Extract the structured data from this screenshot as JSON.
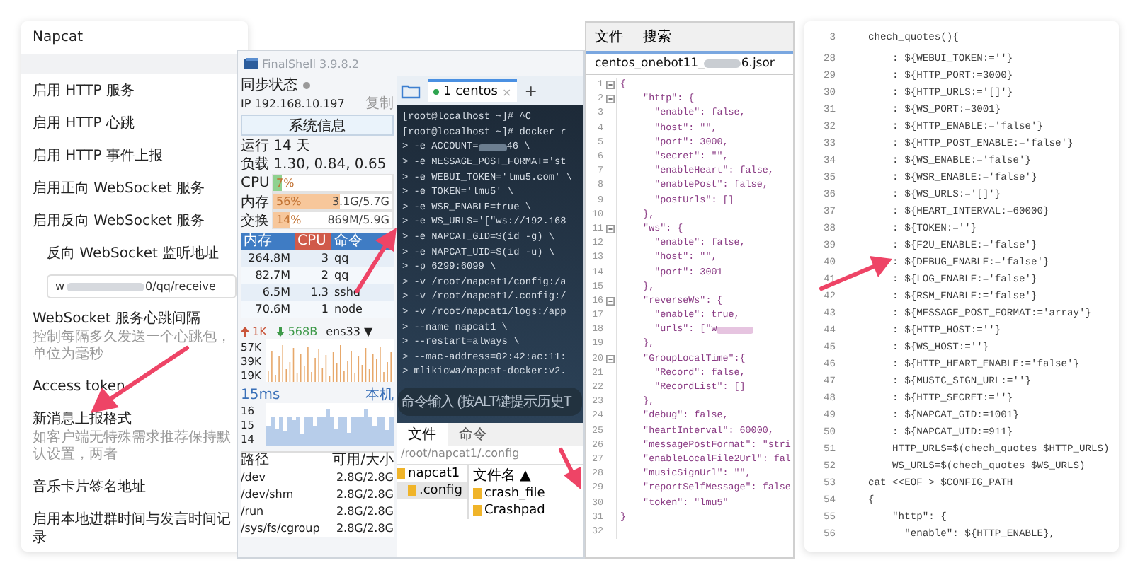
{
  "settings_panel": {
    "title": "Napcat",
    "items": [
      {
        "kind": "row",
        "label": "启用 HTTP 服务"
      },
      {
        "kind": "row",
        "label": "启用 HTTP 心跳"
      },
      {
        "kind": "row",
        "label": "启用 HTTP 事件上报"
      },
      {
        "kind": "row",
        "label": "启用正向 WebSocket 服务"
      },
      {
        "kind": "row",
        "label": "启用反向 WebSocket 服务"
      },
      {
        "kind": "sub",
        "label": "反向 WebSocket 监听地址"
      },
      {
        "kind": "field",
        "value_start": "w",
        "value_end": "0/qq/receive"
      },
      {
        "kind": "row",
        "label": "WebSocket 服务心跳间隔",
        "hint": "控制每隔多久发送一个心跳包，单位为毫秒"
      },
      {
        "kind": "row",
        "label": "Access token"
      },
      {
        "kind": "row",
        "label": "新消息上报格式",
        "hint": "如客户端无特殊需求推荐保持默认设置，两者"
      },
      {
        "kind": "row",
        "label": "音乐卡片签名地址"
      },
      {
        "kind": "row",
        "label": "启用本地进群时间与发言时间记录"
      }
    ]
  },
  "finalshell": {
    "title": "FinalShell 3.9.8.2",
    "sync_label": "同步状态",
    "ip": "IP  192.168.10.197",
    "copy": "复制",
    "sysinfo_button": "系统信息",
    "uptime": "运行 14 天",
    "load": "负载 1.30, 0.84, 0.65",
    "meters": [
      {
        "name": "CPU",
        "percent": "7%",
        "level": 0.07,
        "color": "#8fd18f"
      },
      {
        "name": "内存",
        "percent": "56%",
        "level": 0.56,
        "reading": "3.1G/5.7G",
        "color": "#f7c79b"
      },
      {
        "name": "交换",
        "percent": "14%",
        "level": 0.14,
        "reading": "869M/5.9G",
        "color": "#f7c79b"
      }
    ],
    "processes": {
      "columns": [
        {
          "label": "内存",
          "selected": false
        },
        {
          "label": "CPU",
          "selected": true
        },
        {
          "label": "命令",
          "selected": false
        }
      ],
      "rows": [
        [
          "264.8M",
          "3",
          "qq"
        ],
        [
          "82.7M",
          "2",
          "qq"
        ],
        [
          "6.5M",
          "1.3",
          "sshd"
        ],
        [
          "70.6M",
          "1",
          "node"
        ]
      ]
    },
    "network": {
      "up": "1K",
      "down": "568B",
      "interface": "ens33 ▼",
      "axis": [
        "57K",
        "39K",
        "19K"
      ]
    },
    "ping": {
      "latency": "15ms",
      "host": "本机",
      "axis": [
        "16",
        "15",
        "14"
      ]
    },
    "disks": {
      "columns": [
        "路径",
        "可用/大小"
      ],
      "rows": [
        [
          "/dev",
          "2.8G/2.8G"
        ],
        [
          "/dev/shm",
          "2.8G/2.8G"
        ],
        [
          "/run",
          "2.8G/2.8G"
        ],
        [
          "/sys/fs/cgroup",
          "2.8G/2.8G"
        ]
      ]
    }
  },
  "terminal": {
    "tab": "1 centos",
    "tab_close": "×",
    "new_tab": "+",
    "lines": [
      {
        "text": "[root@localhost ~]# ^C"
      },
      {
        "text": "[root@localhost ~]# docker r"
      },
      {
        "text": "> -e ACCOUNT=",
        "after_blur": "46 \\"
      },
      {
        "text": "> -e MESSAGE_POST_FORMAT='st"
      },
      {
        "text": "> -e WEBUI_TOKEN='lmu5.com' \\"
      },
      {
        "text": "> -e TOKEN='lmu5' \\"
      },
      {
        "text": "> -e WSR_ENABLE=true \\"
      },
      {
        "text": "> -e WS_URLS='[\"ws://192.168"
      },
      {
        "text": "> -e NAPCAT_GID=$(id -g) \\"
      },
      {
        "text": "> -e NAPCAT_UID=$(id -u) \\"
      },
      {
        "text": "> -p 6299:6099 \\"
      },
      {
        "text": "> -v /root/napcat1/config:/a"
      },
      {
        "text": "> -v /root/napcat1/.config:/"
      },
      {
        "text": "> -v /root/napcat1/logs:/app"
      },
      {
        "text": "> --name napcat1 \\"
      },
      {
        "text": "> --restart=always \\"
      },
      {
        "text": "> --mac-address=02:42:ac:11:"
      },
      {
        "text": "> mlikiowa/napcat-docker:v2."
      }
    ],
    "command_hint": "命令输入 (按ALT键提示历史T",
    "bottom_tabs": [
      {
        "label": "文件",
        "selected": true
      },
      {
        "label": "命令",
        "selected": false
      }
    ],
    "path": "/root/napcat1/.config",
    "tree": [
      {
        "label": "napcat1",
        "children": [
          {
            "label": ".config",
            "selected": true
          }
        ]
      }
    ],
    "file_header": "文件名 ▲",
    "files": [
      "crash_file",
      "Crashpad"
    ]
  },
  "json_editor": {
    "menu": [
      "文件",
      "搜索"
    ],
    "tab_start": "centos_onebot11_",
    "tab_end": "6.jsor",
    "lines": [
      {
        "n": "1",
        "fold": true,
        "text": "{"
      },
      {
        "n": "2",
        "fold": true,
        "text": "    \"http\": {"
      },
      {
        "n": "3",
        "fold": false,
        "text": "      \"enable\": false,"
      },
      {
        "n": "4",
        "fold": false,
        "text": "      \"host\": \"\","
      },
      {
        "n": "5",
        "fold": false,
        "text": "      \"port\": 3000,"
      },
      {
        "n": "6",
        "fold": false,
        "text": "      \"secret\": \"\","
      },
      {
        "n": "7",
        "fold": false,
        "text": "      \"enableHeart\": false,"
      },
      {
        "n": "8",
        "fold": false,
        "text": "      \"enablePost\": false,"
      },
      {
        "n": "9",
        "fold": false,
        "text": "      \"postUrls\": []"
      },
      {
        "n": "10",
        "fold": false,
        "text": "    },"
      },
      {
        "n": "11",
        "fold": true,
        "text": "    \"ws\": {"
      },
      {
        "n": "12",
        "fold": false,
        "text": "      \"enable\": false,"
      },
      {
        "n": "13",
        "fold": false,
        "text": "      \"host\": \"\","
      },
      {
        "n": "14",
        "fold": false,
        "text": "      \"port\": 3001"
      },
      {
        "n": "15",
        "fold": false,
        "text": "    },"
      },
      {
        "n": "16",
        "fold": true,
        "text": "    \"reverseWs\": {"
      },
      {
        "n": "17",
        "fold": false,
        "text": "      \"enable\": true,"
      },
      {
        "n": "18",
        "fold": false,
        "text": "      \"urls\": [\"w",
        "blurred": true
      },
      {
        "n": "19",
        "fold": false,
        "text": "    },"
      },
      {
        "n": "20",
        "fold": true,
        "text": "    \"GroupLocalTime\":{"
      },
      {
        "n": "21",
        "fold": false,
        "text": "      \"Record\": false,"
      },
      {
        "n": "22",
        "fold": false,
        "text": "      \"RecordList\": []"
      },
      {
        "n": "23",
        "fold": false,
        "text": "    },"
      },
      {
        "n": "24",
        "fold": false,
        "text": "    \"debug\": false,"
      },
      {
        "n": "25",
        "fold": false,
        "text": "    \"heartInterval\": 60000,"
      },
      {
        "n": "26",
        "fold": false,
        "text": "    \"messagePostFormat\": \"stri"
      },
      {
        "n": "27",
        "fold": false,
        "text": "    \"enableLocalFile2Url\": fal"
      },
      {
        "n": "28",
        "fold": false,
        "text": "    \"musicSignUrl\": \"\","
      },
      {
        "n": "29",
        "fold": false,
        "text": "    \"reportSelfMessage\": false"
      },
      {
        "n": "30",
        "fold": false,
        "text": "    \"token\": \"lmu5\""
      },
      {
        "n": "31",
        "fold": false,
        "text": "}"
      },
      {
        "n": "32",
        "fold": false
      }
    ]
  },
  "script_editor": {
    "lines": [
      {
        "n": "3",
        "text": "    chech_quotes(){"
      },
      {
        "n": "28",
        "text": "        : ${WEBUI_TOKEN:=''}"
      },
      {
        "n": "29",
        "text": "        : ${HTTP_PORT:=3000}"
      },
      {
        "n": "30",
        "text": "        : ${HTTP_URLS:='[]'}"
      },
      {
        "n": "31",
        "text": "        : ${WS_PORT:=3001}"
      },
      {
        "n": "32",
        "text": "        : ${HTTP_ENABLE:='false'}"
      },
      {
        "n": "33",
        "text": "        : ${HTTP_POST_ENABLE:='false'}"
      },
      {
        "n": "34",
        "text": "        : ${WS_ENABLE:='false'}"
      },
      {
        "n": "35",
        "text": "        : ${WSR_ENABLE:='false'}"
      },
      {
        "n": "36",
        "text": "        : ${WS_URLS:='[]'}"
      },
      {
        "n": "37",
        "text": "        : ${HEART_INTERVAL:=60000}"
      },
      {
        "n": "38",
        "text": "        : ${TOKEN:=''}"
      },
      {
        "n": "39",
        "text": "        : ${F2U_ENABLE:='false'}"
      },
      {
        "n": "40",
        "text": "        : ${DEBUG_ENABLE:='false'}"
      },
      {
        "n": "41",
        "text": "        : ${LOG_ENABLE:='false'}"
      },
      {
        "n": "42",
        "text": "        : ${RSM_ENABLE:='false'}"
      },
      {
        "n": "43",
        "text": "        : ${MESSAGE_POST_FORMAT:='array'}"
      },
      {
        "n": "44",
        "text": "        : ${HTTP_HOST:=''}"
      },
      {
        "n": "45",
        "text": "        : ${WS_HOST:=''}"
      },
      {
        "n": "46",
        "text": "        : ${HTTP_HEART_ENABLE:='false'}"
      },
      {
        "n": "47",
        "text": "        : ${MUSIC_SIGN_URL:=''}"
      },
      {
        "n": "48",
        "text": "        : ${HTTP_SECRET:=''}"
      },
      {
        "n": "49",
        "text": "        : ${NAPCAT_GID:=1001}"
      },
      {
        "n": "50",
        "text": "        : ${NAPCAT_UID:=911}"
      },
      {
        "n": "51",
        "text": "        HTTP_URLS=$(chech_quotes $HTTP_URLS)"
      },
      {
        "n": "52",
        "text": "        WS_URLS=$(chech_quotes $WS_URLS)"
      },
      {
        "n": "53",
        "text": "    cat <<EOF > $CONFIG_PATH"
      },
      {
        "n": "54",
        "text": "    {"
      },
      {
        "n": "55",
        "text": "        \"http\": {"
      },
      {
        "n": "56",
        "text": "          \"enable\": ${HTTP_ENABLE},"
      }
    ]
  }
}
